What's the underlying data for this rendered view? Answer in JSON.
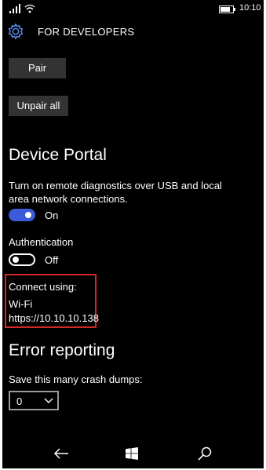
{
  "status": {
    "time": "10:10",
    "battery_level": 0.8
  },
  "header": {
    "title": "FOR DEVELOPERS",
    "icon": "gear-icon"
  },
  "buttons": {
    "pair": "Pair",
    "unpair_all": "Unpair all"
  },
  "device_portal": {
    "heading": "Device Portal",
    "description": "Turn on remote diagnostics over USB and local area network connections.",
    "toggle": {
      "state_label": "On",
      "checked": true
    },
    "authentication": {
      "label": "Authentication",
      "toggle": {
        "state_label": "Off",
        "checked": false
      }
    },
    "connect": {
      "label": "Connect using:",
      "method": "Wi-Fi",
      "url": "https://10.10.10.138"
    }
  },
  "error_reporting": {
    "heading": "Error reporting",
    "dumps_label": "Save this many crash dumps:",
    "dumps_value": "0"
  },
  "nav": {
    "back": "back-arrow-icon",
    "start": "windows-logo-icon",
    "search": "search-icon"
  },
  "colors": {
    "background": "#000000",
    "accent": "#3b5bdb",
    "highlight_border": "#d42727",
    "button_bg": "#333333"
  }
}
